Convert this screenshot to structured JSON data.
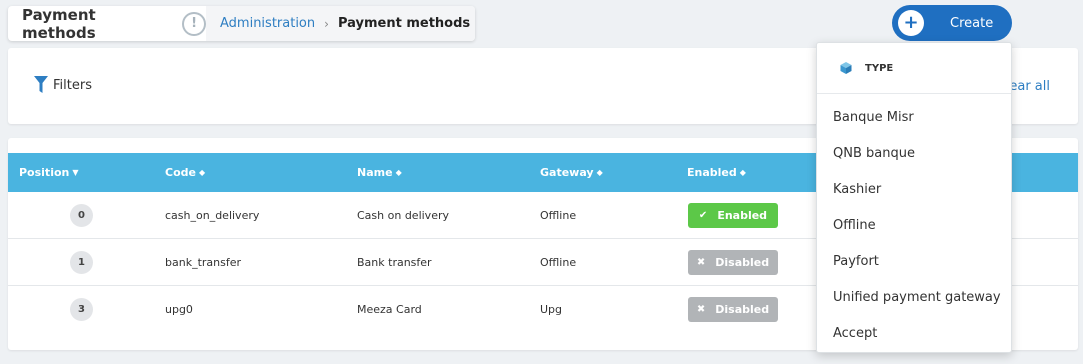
{
  "header": {
    "title": "Payment methods",
    "info_glyph": "!",
    "breadcrumb_parent": "Administration",
    "breadcrumb_sep": "›",
    "breadcrumb_current": "Payment methods"
  },
  "create": {
    "plus": "+",
    "label": "Create"
  },
  "filters": {
    "label": "Filters",
    "clear_all": "lear all"
  },
  "table": {
    "columns": {
      "position": "Position",
      "code": "Code",
      "name": "Name",
      "gateway": "Gateway",
      "enabled": "Enabled"
    },
    "rows": [
      {
        "position": "0",
        "code": "cash_on_delivery",
        "name": "Cash on delivery",
        "gateway": "Offline",
        "status": "Enabled",
        "glyph": "✔"
      },
      {
        "position": "1",
        "code": "bank_transfer",
        "name": "Bank transfer",
        "gateway": "Offline",
        "status": "Disabled",
        "glyph": "✖"
      },
      {
        "position": "3",
        "code": "upg0",
        "name": "Meeza Card",
        "gateway": "Upg",
        "status": "Disabled",
        "glyph": "✖"
      }
    ]
  },
  "dropdown": {
    "heading": "TYPE",
    "items": [
      "Banque Misr",
      "QNB banque",
      "Kashier",
      "Offline",
      "Payfort",
      "Unified payment gateway",
      "Accept"
    ]
  },
  "colors": {
    "accent": "#1f6fc1",
    "table_header": "#4ab4e0",
    "enabled": "#5cc848",
    "disabled": "#b1b4b7",
    "link": "#2e7ec2"
  },
  "icons": {
    "info": "info-icon",
    "create": "plus-icon",
    "filter": "funnel-icon",
    "type": "cube-icon",
    "sort_desc": "caret-down-icon",
    "sort": "sort-icon",
    "enabled": "check-icon",
    "disabled": "x-icon"
  }
}
